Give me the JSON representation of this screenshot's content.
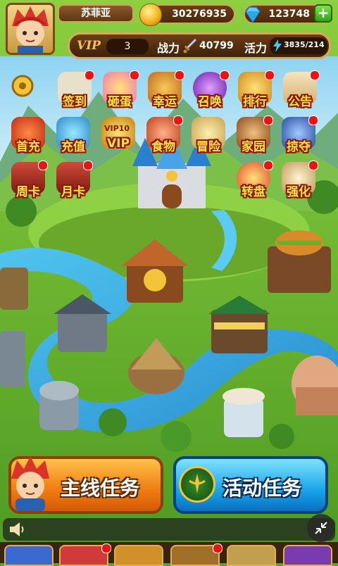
{
  "player": {
    "name": "苏菲亚",
    "gold": "30276935",
    "gems": "123748",
    "vip_label": "VIP",
    "vip_level": "3",
    "power_label": "战力",
    "power": "40799",
    "energy_label": "活力",
    "energy": "3835/214"
  },
  "menu": {
    "row1": [
      {
        "label": "签到",
        "icon": "scroll-icon",
        "dot": true
      },
      {
        "label": "砸蛋",
        "icon": "egg-icon",
        "dot": true
      },
      {
        "label": "幸运",
        "icon": "lucky-chest-icon",
        "dot": true
      },
      {
        "label": "召唤",
        "icon": "summon-orb-icon",
        "dot": true
      },
      {
        "label": "排行",
        "icon": "ranking-trophy-icon",
        "dot": true
      },
      {
        "label": "公告",
        "icon": "notice-scroll-icon",
        "dot": true
      }
    ],
    "row2": [
      {
        "label": "首充",
        "icon": "first-charge-icon",
        "dot": false
      },
      {
        "label": "充值",
        "icon": "recharge-icon",
        "dot": false
      },
      {
        "label": "VIP",
        "icon": "vip-crown-icon",
        "dot": false,
        "badge": "VIP10"
      },
      {
        "label": "食物",
        "icon": "food-icon",
        "dot": true
      },
      {
        "label": "冒险",
        "icon": "adventure-icon",
        "dot": false
      },
      {
        "label": "家园",
        "icon": "home-icon",
        "dot": true
      },
      {
        "label": "掠夺",
        "icon": "plunder-icon",
        "dot": true
      }
    ],
    "row3": [
      {
        "label": "周卡",
        "icon": "weekly-card-icon",
        "dot": true
      },
      {
        "label": "月卡",
        "icon": "monthly-card-icon",
        "dot": true
      },
      {
        "label": "转盘",
        "icon": "wheel-icon",
        "dot": true
      },
      {
        "label": "强化",
        "icon": "enhance-icon",
        "dot": true
      }
    ]
  },
  "tasks": {
    "main": "主线任务",
    "event": "活动任务"
  },
  "colors": {
    "label_fill": "#ffe14a",
    "label_outline": "#8a1a00",
    "notify_dot": "#ee1313",
    "main_task": "#f07b12",
    "event_task": "#1aa4e8"
  }
}
